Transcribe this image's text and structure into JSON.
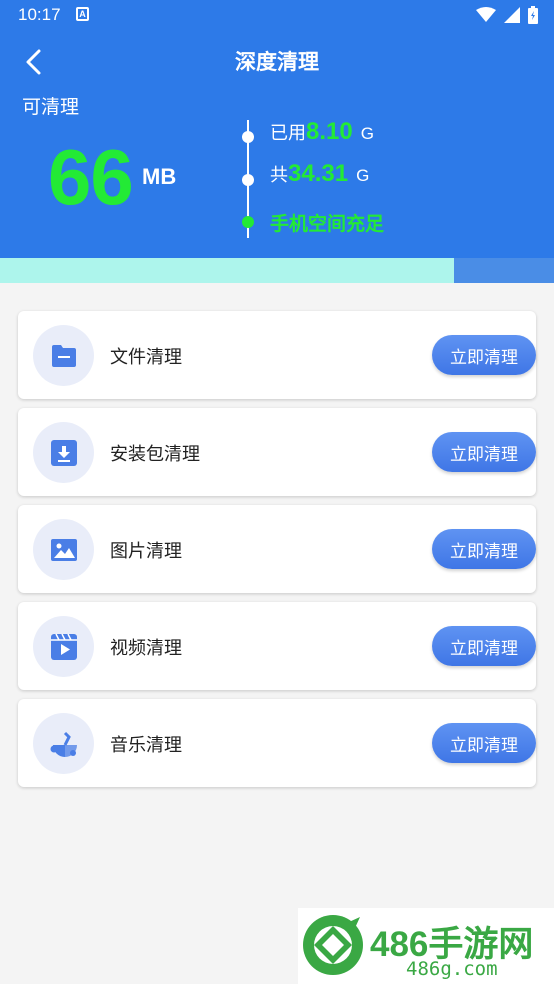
{
  "status_bar": {
    "time": "10:17",
    "a_badge": "A"
  },
  "header": {
    "title": "深度清理",
    "cleanable_label": "可清理",
    "cleanable_value": "66",
    "cleanable_unit": "MB",
    "used_label": "已用",
    "used_value": "8.10",
    "used_unit": "G",
    "total_label": "共",
    "total_value": "34.31",
    "total_unit": "G",
    "status_message": "手机空间充足"
  },
  "progress": {
    "fraction_used": 0.819,
    "fill_color": "#adf5ec",
    "track_color": "#4a8de6"
  },
  "items": [
    {
      "label": "文件清理",
      "button": "立即清理",
      "icon": "folder-icon"
    },
    {
      "label": "安装包清理",
      "button": "立即清理",
      "icon": "download-package-icon"
    },
    {
      "label": "图片清理",
      "button": "立即清理",
      "icon": "image-icon"
    },
    {
      "label": "视频清理",
      "button": "立即清理",
      "icon": "video-icon"
    },
    {
      "label": "音乐清理",
      "button": "立即清理",
      "icon": "music-icon"
    }
  ],
  "watermark": {
    "title": "486手游网",
    "url": "486g.com"
  },
  "colors": {
    "header_bg": "#2d7ae8",
    "accent_green": "#23ea35",
    "button_blue": "#3f76e6",
    "icon_blue": "#4a7ee6"
  }
}
